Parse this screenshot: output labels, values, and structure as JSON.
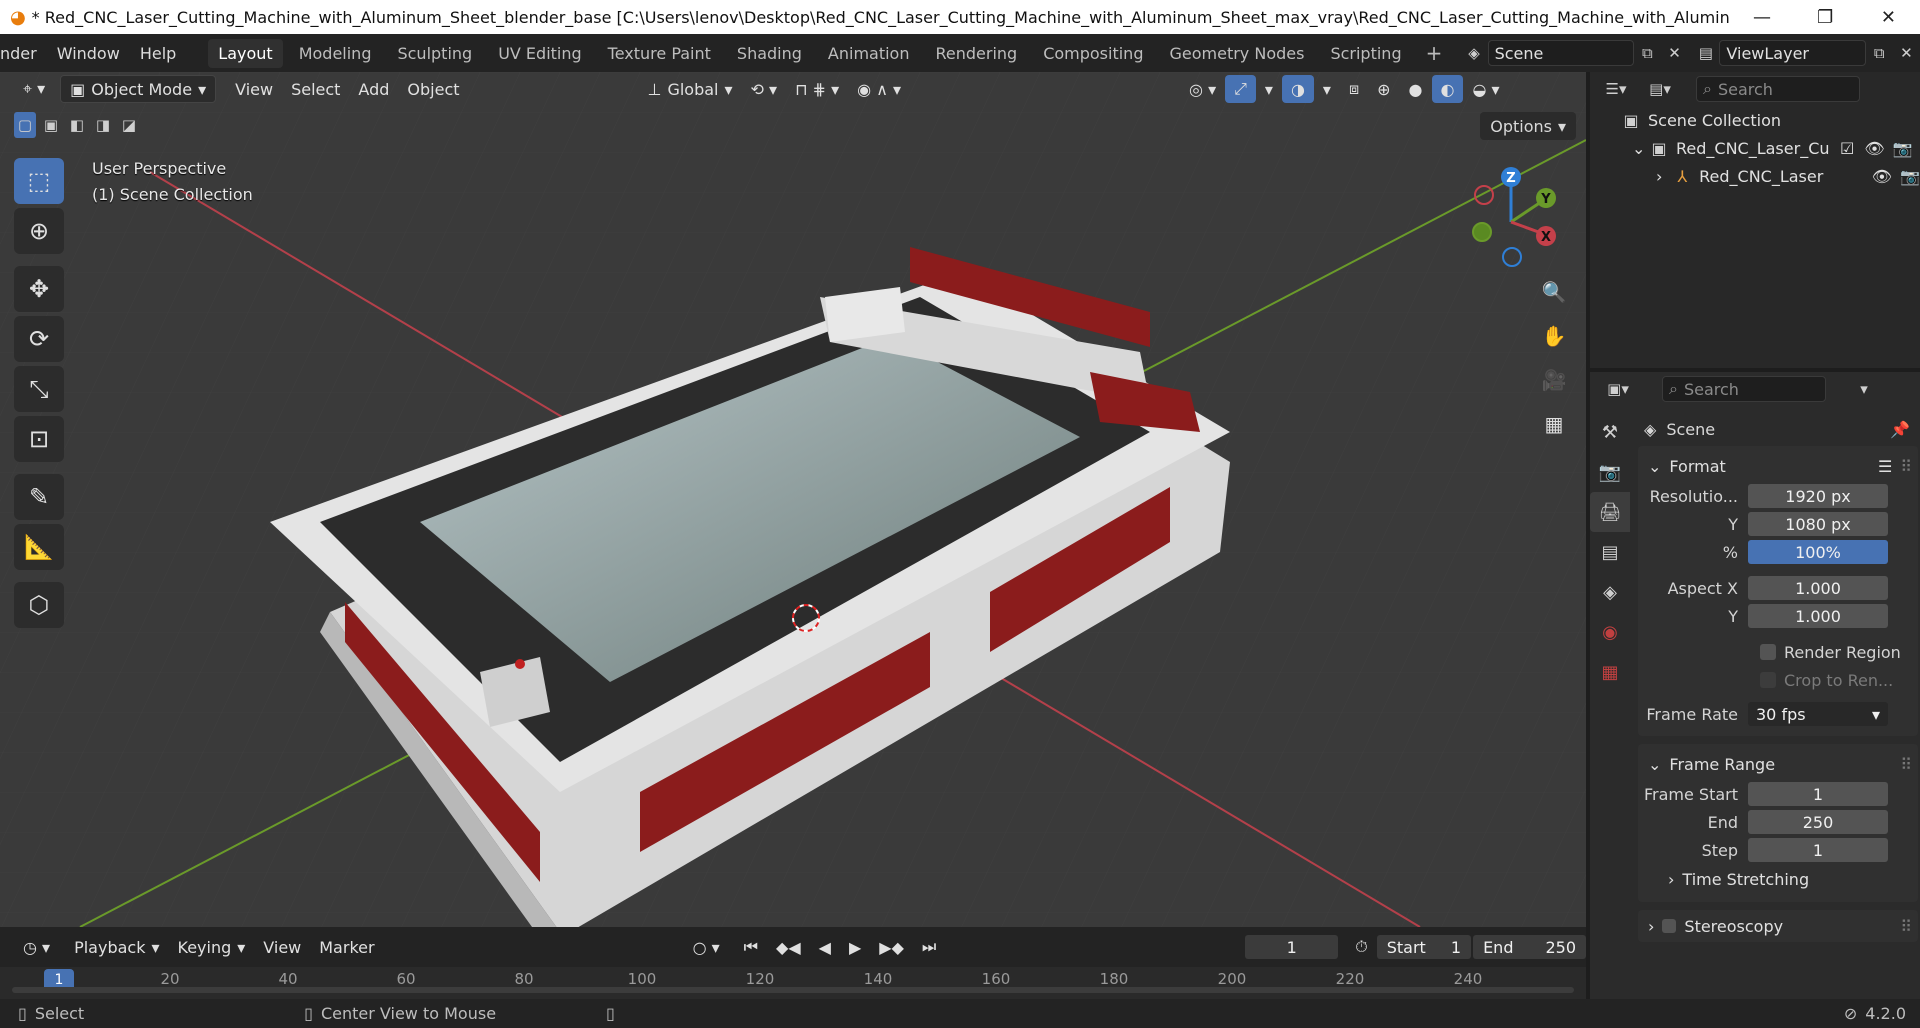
{
  "titlebar": {
    "title": "* Red_CNC_Laser_Cutting_Machine_with_Aluminum_Sheet_blender_base [C:\\Users\\lenov\\Desktop\\Red_CNC_Laser_Cutting_Machine_with_Aluminum_Sheet_max_vray\\Red_CNC_Laser_Cutting_Machine_with_Aluminum_Sheet...",
    "minimize": "—",
    "maximize": "❐",
    "close": "✕"
  },
  "menu": [
    "nder",
    "Window",
    "Help"
  ],
  "workspaces": [
    "Layout",
    "Modeling",
    "Sculpting",
    "UV Editing",
    "Texture Paint",
    "Shading",
    "Animation",
    "Rendering",
    "Compositing",
    "Geometry Nodes",
    "Scripting"
  ],
  "active_workspace": "Layout",
  "scene": {
    "name": "Scene",
    "view_layer": "ViewLayer"
  },
  "viewport": {
    "mode": "Object Mode",
    "menus": [
      "View",
      "Select",
      "Add",
      "Object"
    ],
    "orientation": "Global",
    "options_label": "Options",
    "overlay_line1": "User Perspective",
    "overlay_line2": "(1) Scene Collection",
    "gizmo": {
      "z": "Z",
      "y": "Y",
      "x": "X"
    }
  },
  "outliner": {
    "search_placeholder": "Search",
    "rows": [
      {
        "label": "Scene Collection"
      },
      {
        "label": "Red_CNC_Laser_Cu"
      },
      {
        "label": "Red_CNC_Laser"
      }
    ]
  },
  "properties": {
    "search_placeholder": "Search",
    "context": "Scene",
    "format": {
      "title": "Format",
      "resolution_label": "Resolutio...",
      "res_x": "1920 px",
      "y_label": "Y",
      "res_y": "1080 px",
      "pct_label": "%",
      "res_pct": "100%",
      "aspect_label": "Aspect X",
      "aspect_x": "1.000",
      "aspect_y": "1.000",
      "render_region": "Render Region",
      "crop": "Crop to Ren...",
      "frame_rate_label": "Frame Rate",
      "frame_rate": "30 fps"
    },
    "frame_range": {
      "title": "Frame Range",
      "start_label": "Frame Start",
      "start": "1",
      "end_label": "End",
      "end": "250",
      "step_label": "Step",
      "step": "1"
    },
    "time_stretching": "Time Stretching",
    "stereoscopy": "Stereoscopy"
  },
  "timeline": {
    "menus": [
      "Playback",
      "Keying",
      "View",
      "Marker"
    ],
    "current_frame": "1",
    "start_label": "Start",
    "start": "1",
    "end_label": "End",
    "end": "250",
    "ruler_current": "1",
    "ticks": [
      "20",
      "40",
      "60",
      "80",
      "100",
      "120",
      "140",
      "160",
      "180",
      "200",
      "220",
      "240"
    ]
  },
  "statusbar": {
    "select": "Select",
    "center_view": "Center View to Mouse",
    "version": "4.2.0"
  },
  "colors": {
    "accent": "#4772b3",
    "machine_red": "#8b1c1c",
    "machine_white": "#dcdcdc",
    "axis_x": "#c4404a",
    "axis_y": "#6a9a2a",
    "gizmo_z": "#2f7fd6"
  }
}
